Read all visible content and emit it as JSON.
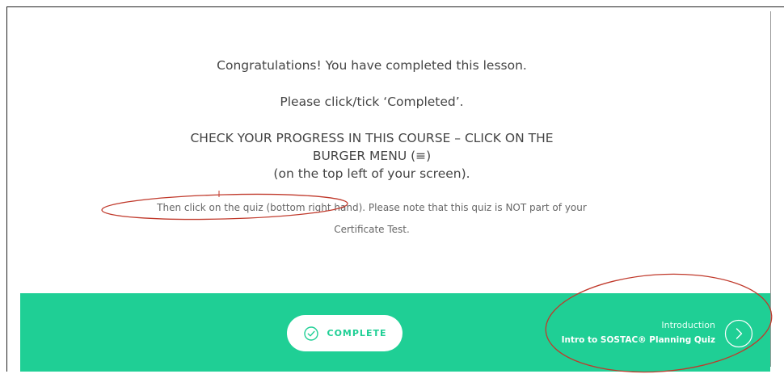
{
  "lesson": {
    "congrats": "Congratulations! You have completed this lesson.",
    "instruction": "Please click/tick ‘Completed’.",
    "progress_line1": "CHECK YOUR PROGRESS IN THIS COURSE – CLICK ON THE",
    "progress_line2": "BURGER MENU (≡)",
    "progress_line3": "(on the top left of your screen).",
    "note_line1": "Then click on the quiz (bottom right hand). Please note that this quiz is NOT part of your",
    "note_line2": "Certificate Test."
  },
  "footer": {
    "complete_label": "COMPLETE",
    "complete_icon": "check-circle-icon",
    "next_kicker": "Introduction",
    "next_title": "Intro to SOSTAC® Planning Quiz",
    "next_icon": "chevron-right-circle-icon"
  },
  "colors": {
    "accent": "#1fcf95",
    "annotation": "#c0392b",
    "text": "#444444"
  }
}
